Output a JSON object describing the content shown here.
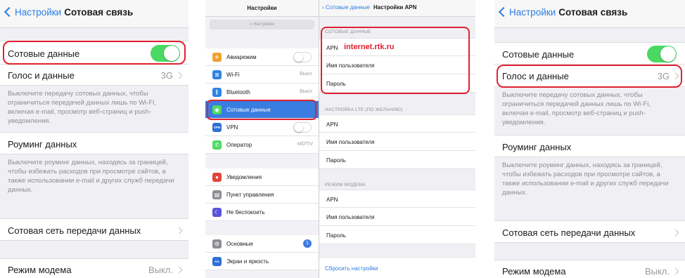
{
  "left_phone": {
    "back_label": "Настройки",
    "title": "Сотовая связь",
    "cellular_data": {
      "label": "Сотовые данные",
      "enabled": true
    },
    "voice_data": {
      "label": "Голос и данные",
      "value": "3G"
    },
    "cellular_note": "Выключите передачу сотовых данных, чтобы ограничиться передачей данных лишь по Wi-Fi, включая e-mail, просмотр веб-страниц и push-уведомления.",
    "roaming": {
      "label": "Роуминг данных"
    },
    "roaming_note": "Выключите роуминг данных, находясь за границей, чтобы избежать расходов при просмотре сайтов, а также использовании e-mail и других служб передачи данных.",
    "cellular_network": {
      "label": "Сотовая сеть передачи данных"
    },
    "hotspot": {
      "label": "Режим модема",
      "value": "Выкл."
    }
  },
  "ipad": {
    "sidebar_title": "Настройки",
    "search_placeholder": "Настройки",
    "items": [
      {
        "label": "Авиарежим",
        "icon": "airplane-icon",
        "color": "#f2a12e"
      },
      {
        "label": "Wi-Fi",
        "value": "Выкл.",
        "icon": "wifi-icon",
        "color": "#2f82e6"
      },
      {
        "label": "Bluetooth",
        "value": "Выкл.",
        "icon": "bluetooth-icon",
        "color": "#2f82e6"
      },
      {
        "label": "Сотовые данные",
        "icon": "cellular-icon",
        "color": "#4cd964",
        "selected": true
      },
      {
        "label": "VPN",
        "icon": "vpn-icon",
        "color": "#2f6fd6"
      },
      {
        "label": "Оператор",
        "value": "MOTIV",
        "icon": "phone-icon",
        "color": "#4cd964"
      },
      {
        "label": "Уведомления",
        "icon": "notifications-icon",
        "color": "#e3453a"
      },
      {
        "label": "Пункт управления",
        "icon": "control-center-icon",
        "color": "#8e8e93"
      },
      {
        "label": "Не беспокоить",
        "icon": "moon-icon",
        "color": "#5856d6"
      },
      {
        "label": "Основные",
        "icon": "gear-icon",
        "color": "#8e8e93",
        "badge": "1"
      },
      {
        "label": "Экран и яркость",
        "icon": "brightness-icon",
        "color": "#2f6fd6"
      }
    ],
    "detail_back": "Сотовые данные",
    "detail_title": "Настройки APN",
    "section1_header": "СОТОВЫЕ ДАННЫЕ",
    "apn_label": "APN",
    "apn_value": "internet.rtk.ru",
    "username_label": "Имя пользователя",
    "password_label": "Пароль",
    "section2_header": "НАСТРОЙКА LTE (ПО ЖЕЛАНИЮ)",
    "section3_header": "РЕЖИМ МОДЕМА",
    "reset_label": "Сбросить настройки"
  },
  "right_phone": {
    "back_label": "Настройки",
    "title": "Сотовая связь",
    "cellular_data": {
      "label": "Сотовые данные",
      "enabled": true
    },
    "voice_data": {
      "label": "Голос и данные",
      "value": "3G"
    },
    "cellular_note": "Выключите передачу сотовых данных, чтобы ограничиться передачей данных лишь по Wi-Fi, включая e-mail, просмотр веб-страниц и push-уведомления.",
    "roaming": {
      "label": "Роуминг данных"
    },
    "roaming_note": "Выключите роуминг данных, находясь за границей, чтобы избежать расходов при просмотре сайтов, а также использовании e-mail и других служб передачи данных.",
    "cellular_network": {
      "label": "Сотовая сеть передачи данных"
    },
    "hotspot": {
      "label": "Режим модема",
      "value": "Выкл."
    }
  }
}
